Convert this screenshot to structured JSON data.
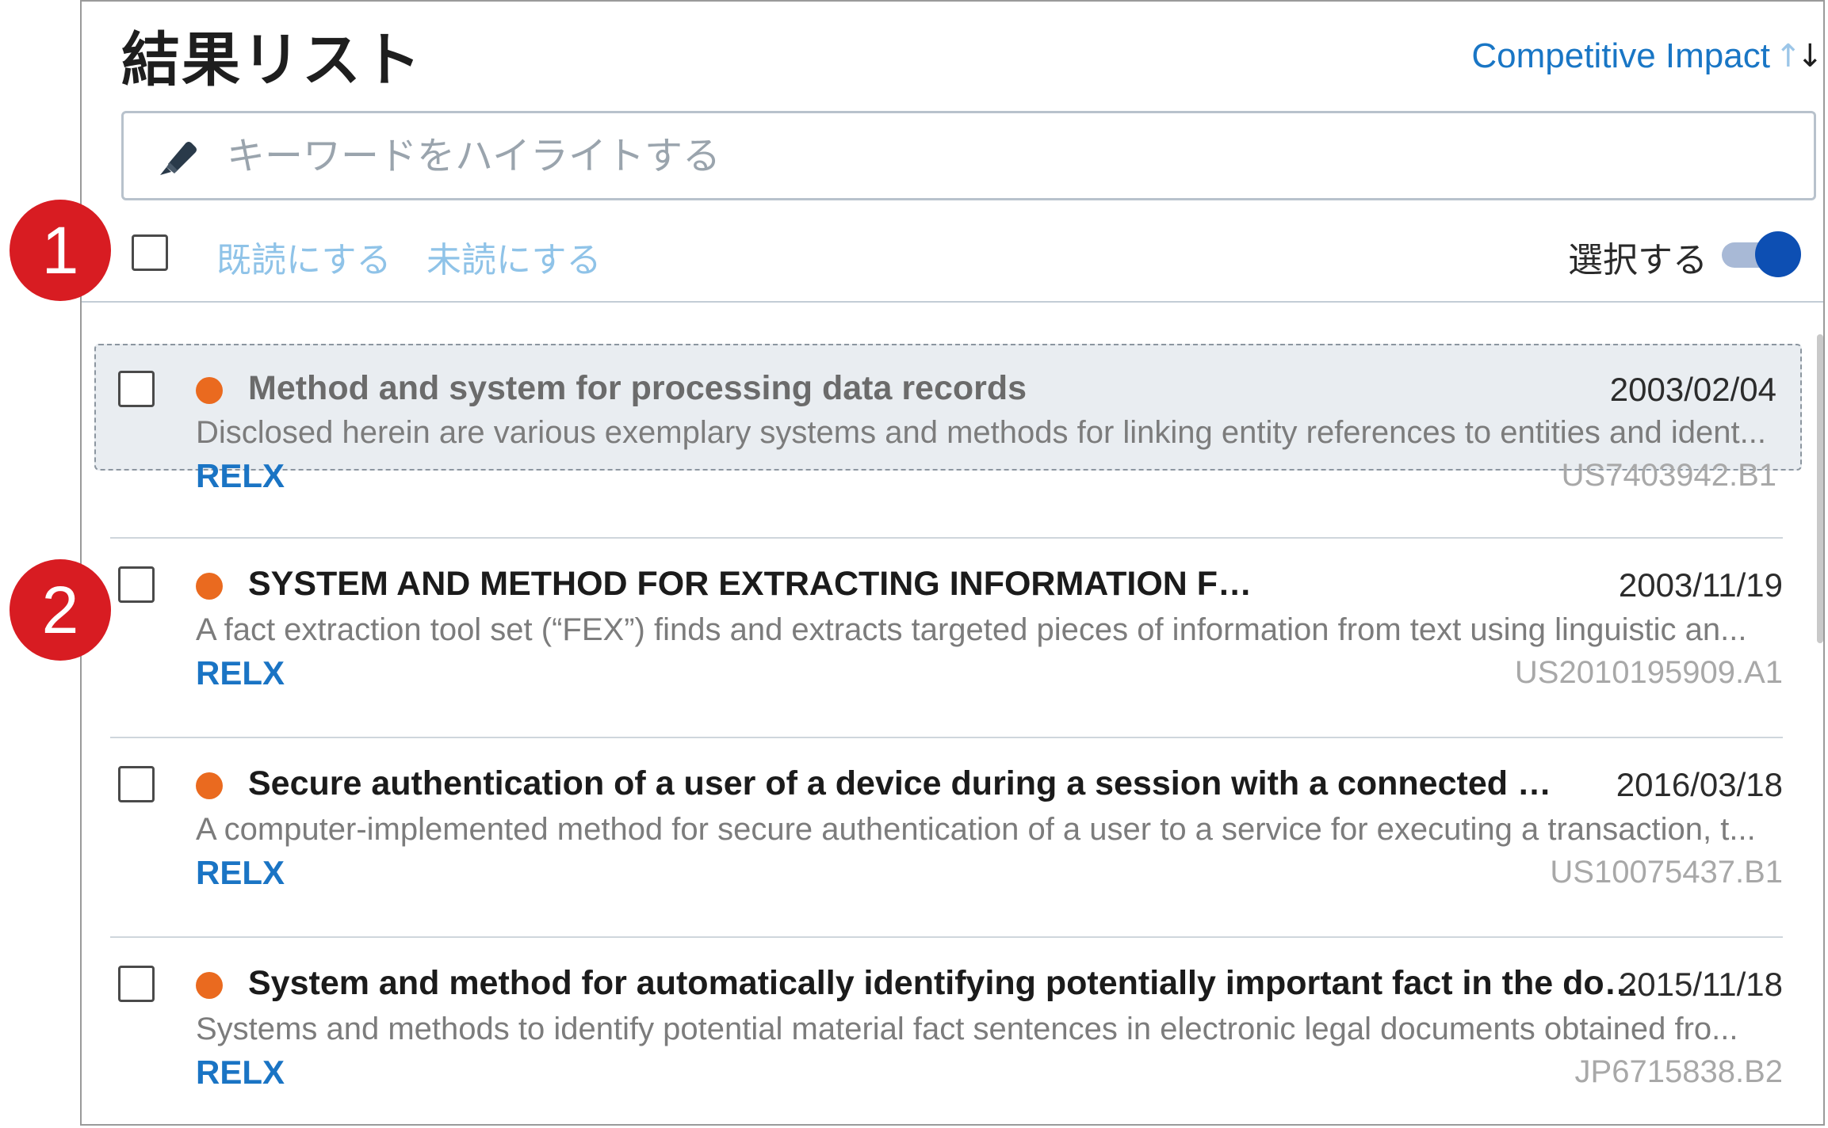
{
  "header": {
    "title": "結果リスト",
    "sort_label": "Competitive Impact",
    "sort_icon": "sort-arrows-icon"
  },
  "search": {
    "placeholder": "キーワードをハイライトする",
    "value": "",
    "icon": "highlighter-icon"
  },
  "toolbar": {
    "mark_read": "既読にする",
    "mark_unread": "未読にする",
    "select_label": "選択する",
    "select_toggle_on": true
  },
  "results": [
    {
      "title": "Method and system for processing data records",
      "date": "2003/02/04",
      "abstract": "Disclosed herein are various exemplary systems and methods for linking entity references to entities and ident...",
      "source": "RELX",
      "patent_number": "US7403942.B1",
      "focused": true
    },
    {
      "title": "SYSTEM AND METHOD FOR EXTRACTING INFORMATION FROM TEXT USING TEXT A...",
      "date": "2003/11/19",
      "abstract": "A fact extraction tool set (“FEX”) finds and extracts targeted pieces of information from text using linguistic an...",
      "source": "RELX",
      "patent_number": "US2010195909.A1",
      "focused": false
    },
    {
      "title": "Secure authentication of a user of a device during a session with a connected server",
      "date": "2016/03/18",
      "abstract": "A computer-implemented method for secure authentication of a user to a service for executing a transaction, t...",
      "source": "RELX",
      "patent_number": "US10075437.B1",
      "focused": false
    },
    {
      "title": "System and method for automatically identifying potentially important fact in the document",
      "date": "2015/11/18",
      "abstract": "Systems and methods to identify potential material fact sentences in electronic legal documents obtained fro...",
      "source": "RELX",
      "patent_number": "JP6715838.B2",
      "focused": false
    }
  ],
  "annotations": {
    "badge_1": "1",
    "badge_2": "2"
  },
  "colors": {
    "accent_blue": "#1976c5",
    "status_dot": "#ea6a1f",
    "badge_red": "#d81c22",
    "toggle_knob": "#0d4fb3"
  }
}
